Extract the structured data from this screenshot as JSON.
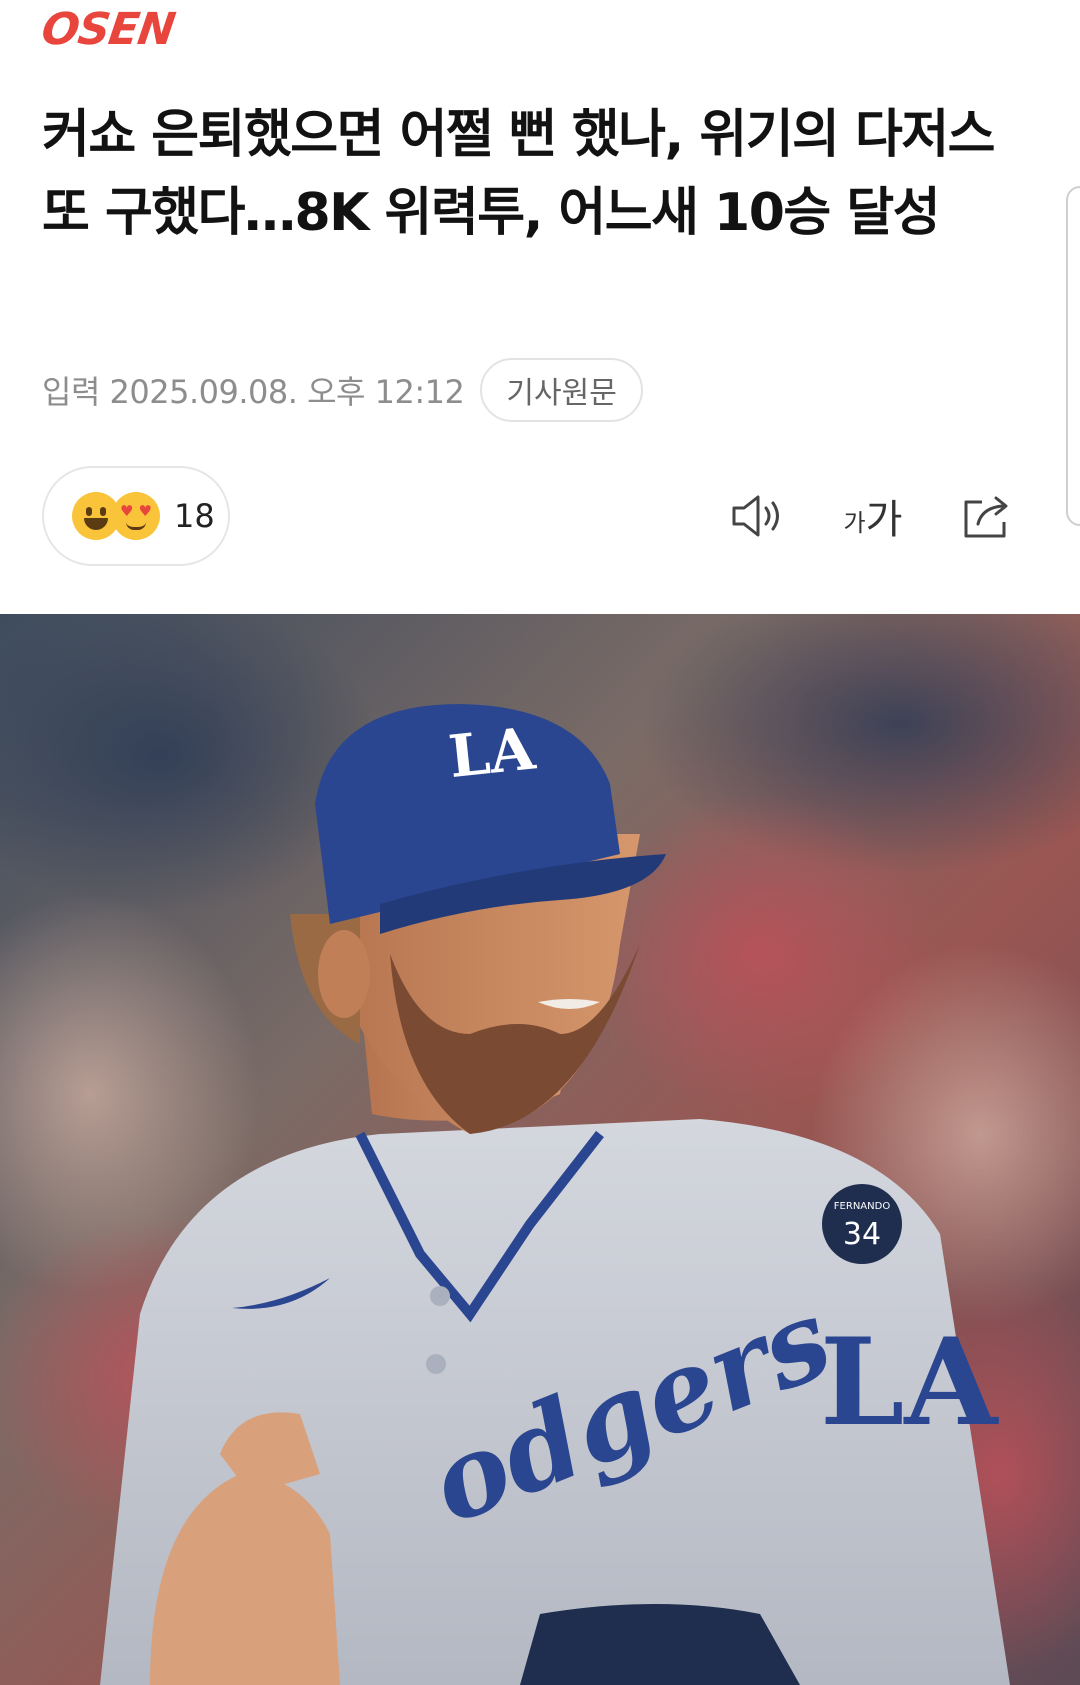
{
  "site": {
    "logo_text": "OSEN"
  },
  "article": {
    "title": "커쇼 은퇴했으면 어쩔 뻔 했나, 위기의 다저스 또 구했다…8K 위력투, 어느새 10승 달성",
    "published": "입력 2025.09.08. 오후 12:12",
    "source_button": "기사원문"
  },
  "reactions": {
    "icons": [
      "grinning-face",
      "heart-eyes-face"
    ],
    "count": "18"
  },
  "toolbar": {
    "tts_icon": "speaker-icon",
    "font_small": "가",
    "font_large": "가",
    "share_icon": "share-icon"
  },
  "photo": {
    "cap_logo": "LA",
    "jersey_text": "Dodgers",
    "sleeve_logo": "LA",
    "patch_text": "FERNANDO",
    "patch_number": "34"
  },
  "colors": {
    "brand": "#e8463c",
    "dodger_blue": "#2b4690",
    "jersey_gray": "#c9ccd3"
  }
}
